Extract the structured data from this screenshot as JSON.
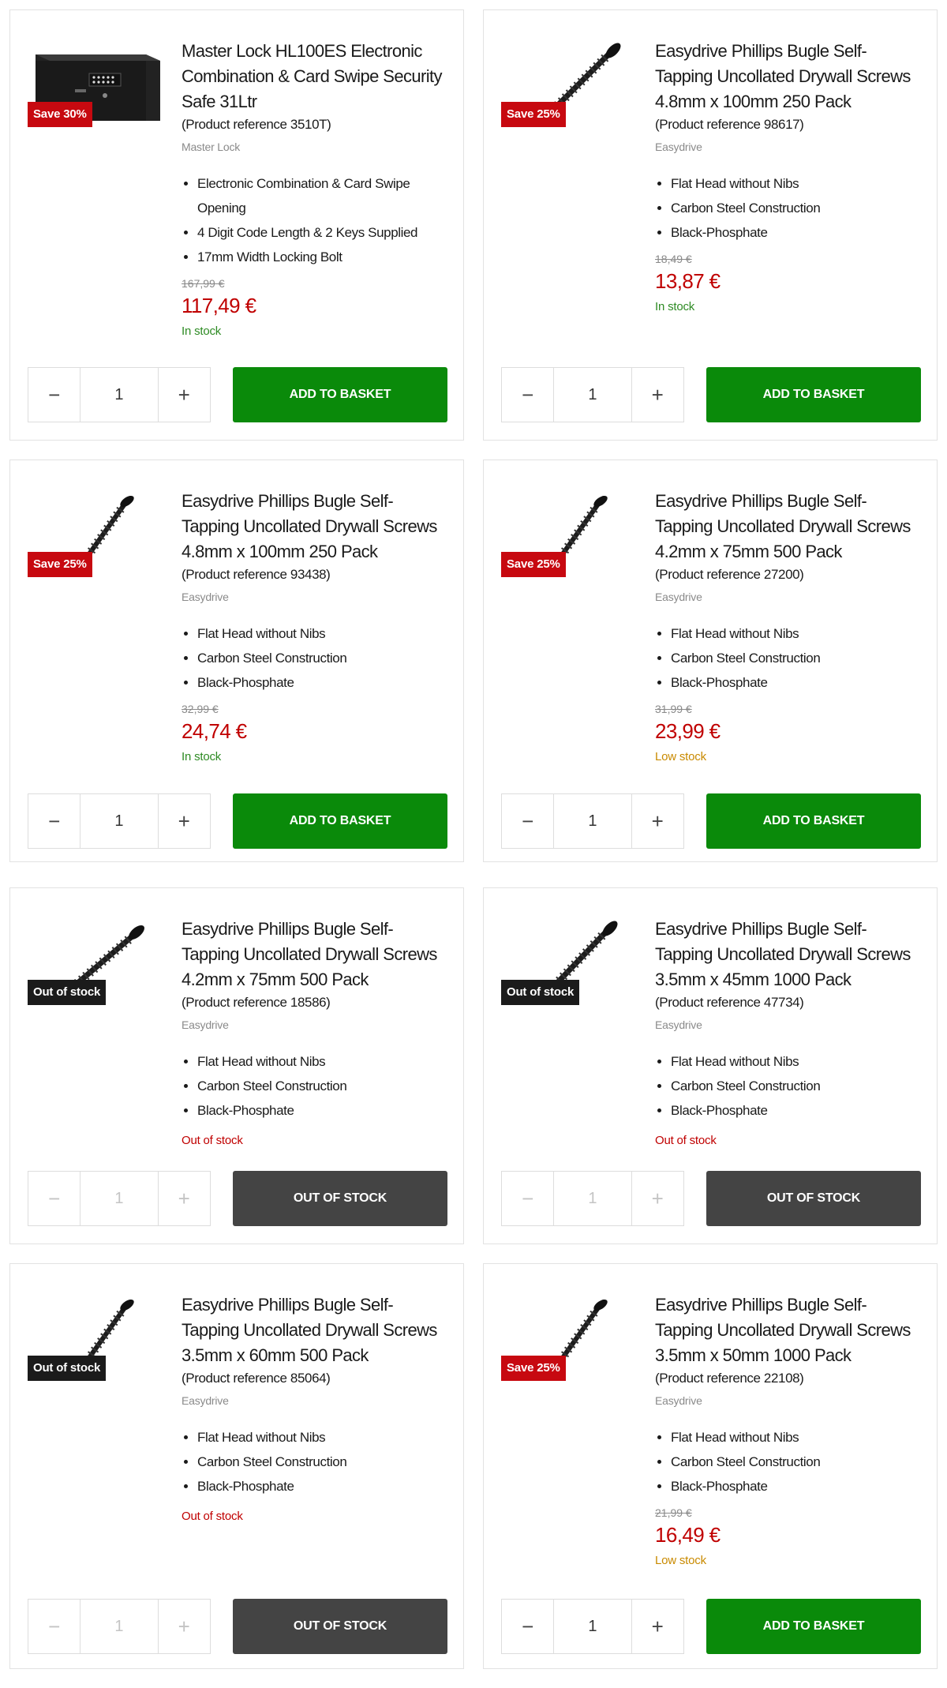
{
  "products": [
    {
      "title": "Master Lock HL100ES Electronic Combination & Card Swipe Security Safe 31Ltr",
      "reference": "(Product reference 3510T)",
      "brand": "Master Lock",
      "badge": "Save 30%",
      "image": "safe-image",
      "features": [
        "Electronic Combination & Card Swipe Opening",
        "4 Digit Code Length & 2 Keys Supplied",
        "17mm Width Locking Bolt"
      ],
      "old_price": "167,99 €",
      "price": "117,49 €",
      "stock": "In stock",
      "quantity": "1",
      "button": "ADD TO BASKET"
    },
    {
      "title": "Easydrive Phillips Bugle Self-Tapping Uncollated Drywall Screws 4.8mm x 100mm 250 Pack",
      "reference": "(Product reference 98617)",
      "brand": "Easydrive",
      "badge": "Save 25%",
      "image": "screw-image",
      "features": [
        "Flat Head without Nibs",
        "Carbon Steel Construction",
        "Black-Phosphate"
      ],
      "old_price": "18,49 €",
      "price": "13,87 €",
      "stock": "In stock",
      "quantity": "1",
      "button": "ADD TO BASKET"
    },
    {
      "title": "Easydrive Phillips Bugle Self-Tapping Uncollated Drywall Screws 4.8mm x 100mm 250 Pack",
      "reference": "(Product reference 93438)",
      "brand": "Easydrive",
      "badge": "Save 25%",
      "image": "screw-image",
      "features": [
        "Flat Head without Nibs",
        "Carbon Steel Construction",
        "Black-Phosphate"
      ],
      "old_price": "32,99 €",
      "price": "24,74 €",
      "stock": "In stock",
      "quantity": "1",
      "button": "ADD TO BASKET"
    },
    {
      "title": "Easydrive Phillips Bugle Self-Tapping Uncollated Drywall Screws 4.2mm x 75mm 500 Pack",
      "reference": "(Product reference 27200)",
      "brand": "Easydrive",
      "badge": "Save 25%",
      "image": "screw-image",
      "features": [
        "Flat Head without Nibs",
        "Carbon Steel Construction",
        "Black-Phosphate"
      ],
      "old_price": "31,99 €",
      "price": "23,99 €",
      "stock": "Low stock",
      "quantity": "1",
      "button": "ADD TO BASKET"
    },
    {
      "title": "Easydrive Phillips Bugle Self-Tapping Uncollated Drywall Screws 4.2mm x 75mm 500 Pack",
      "reference": "(Product reference 18586)",
      "brand": "Easydrive",
      "badge": "Out of stock",
      "image": "screw-image",
      "features": [
        "Flat Head without Nibs",
        "Carbon Steel Construction",
        "Black-Phosphate"
      ],
      "old_price": "",
      "price": "",
      "stock": "Out of stock",
      "quantity": "1",
      "button": "OUT OF STOCK"
    },
    {
      "title": "Easydrive Phillips Bugle Self-Tapping Uncollated Drywall Screws 3.5mm x 45mm 1000 Pack",
      "reference": "(Product reference 47734)",
      "brand": "Easydrive",
      "badge": "Out of stock",
      "image": "screw-image",
      "features": [
        "Flat Head without Nibs",
        "Carbon Steel Construction",
        "Black-Phosphate"
      ],
      "old_price": "",
      "price": "",
      "stock": "Out of stock",
      "quantity": "1",
      "button": "OUT OF STOCK"
    },
    {
      "title": "Easydrive Phillips Bugle Self-Tapping Uncollated Drywall Screws 3.5mm x 60mm 500 Pack",
      "reference": "(Product reference 85064)",
      "brand": "Easydrive",
      "badge": "Out of stock",
      "image": "screw-image",
      "features": [
        "Flat Head without Nibs",
        "Carbon Steel Construction",
        "Black-Phosphate"
      ],
      "old_price": "",
      "price": "",
      "stock": "Out of stock",
      "quantity": "1",
      "button": "OUT OF STOCK"
    },
    {
      "title": "Easydrive Phillips Bugle Self-Tapping Uncollated Drywall Screws 3.5mm x 50mm 1000 Pack",
      "reference": "(Product reference 22108)",
      "brand": "Easydrive",
      "badge": "Save 25%",
      "image": "screw-image",
      "features": [
        "Flat Head without Nibs",
        "Carbon Steel Construction",
        "Black-Phosphate"
      ],
      "old_price": "21,99 €",
      "price": "16,49 €",
      "stock": "Low stock",
      "quantity": "1",
      "button": "ADD TO BASKET"
    }
  ],
  "quantity_controls": {
    "minus": "−",
    "plus": "+"
  },
  "colors": {
    "add_button": "#0a8a0a",
    "out_button": "#444444",
    "save_badge": "#c70910",
    "oos_badge": "#1b1b1b",
    "price": "#c00000",
    "in_stock": "#2e8b24",
    "low_stock": "#c98a00"
  }
}
